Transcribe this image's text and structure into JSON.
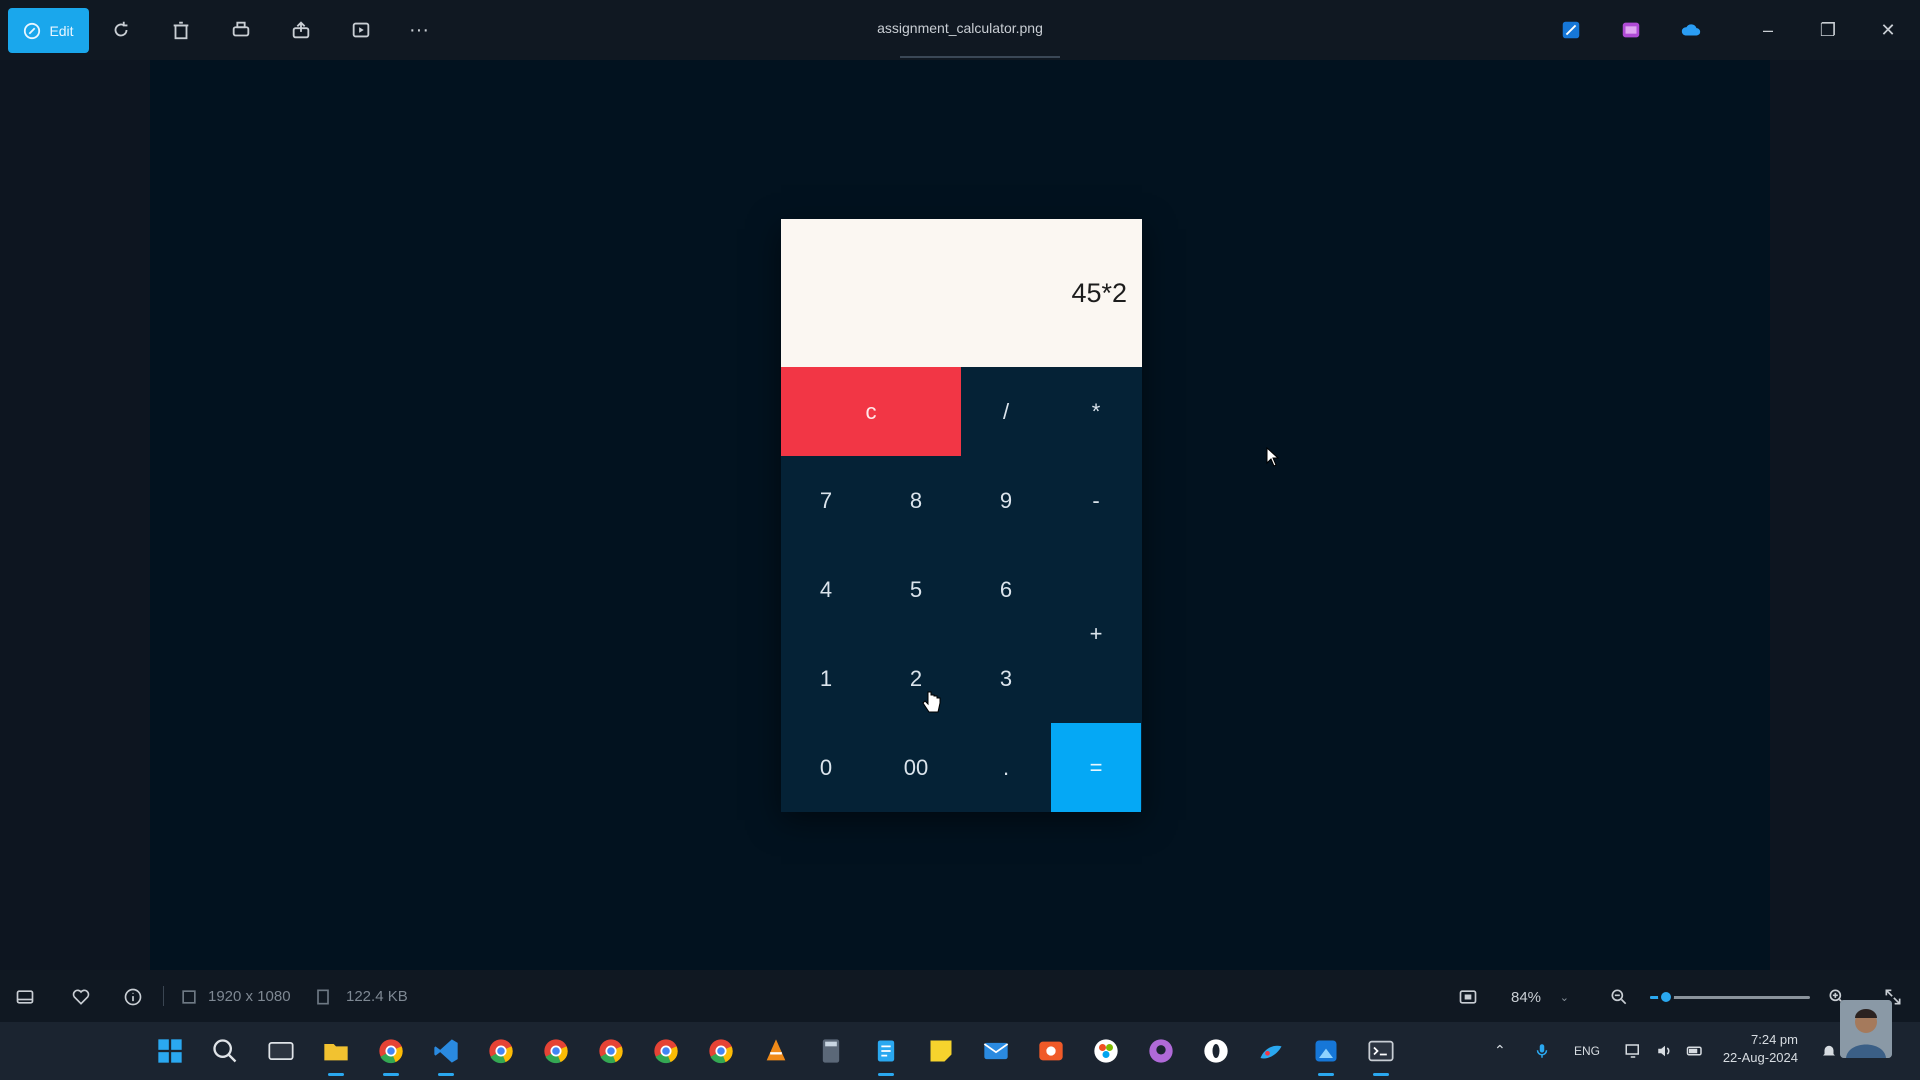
{
  "app": {
    "file_title": "assignment_calculator.png",
    "edit_label": "Edit"
  },
  "toolbar": {
    "icons": [
      "rotate-icon",
      "delete-icon",
      "print-icon",
      "share-icon",
      "slideshow-icon",
      "more-icon"
    ],
    "more_label": "···"
  },
  "window_controls": {
    "minimize": "–",
    "maximize": "❐",
    "close": "✕"
  },
  "calculator": {
    "display": "45*2",
    "keys": {
      "clear": "c",
      "divide": "/",
      "multiply": "*",
      "k7": "7",
      "k8": "8",
      "k9": "9",
      "minus": "-",
      "k4": "4",
      "k5": "5",
      "k6": "6",
      "plus": "+",
      "k1": "1",
      "k2": "2",
      "k3": "3",
      "k0": "0",
      "k00": "00",
      "dot": ".",
      "equal": "="
    },
    "colors": {
      "display_bg": "#fbf7f2",
      "key_bg": "#052236",
      "clear_bg": "#f23645",
      "equal_bg": "#05a8f5"
    }
  },
  "statusbar": {
    "dimensions": "1920 x 1080",
    "file_size": "122.4 KB",
    "zoom": "84%",
    "zoom_fraction": 0.1
  },
  "taskbar": {
    "language": "ENG",
    "time": "7:24 pm",
    "date": "22-Aug-2024"
  }
}
